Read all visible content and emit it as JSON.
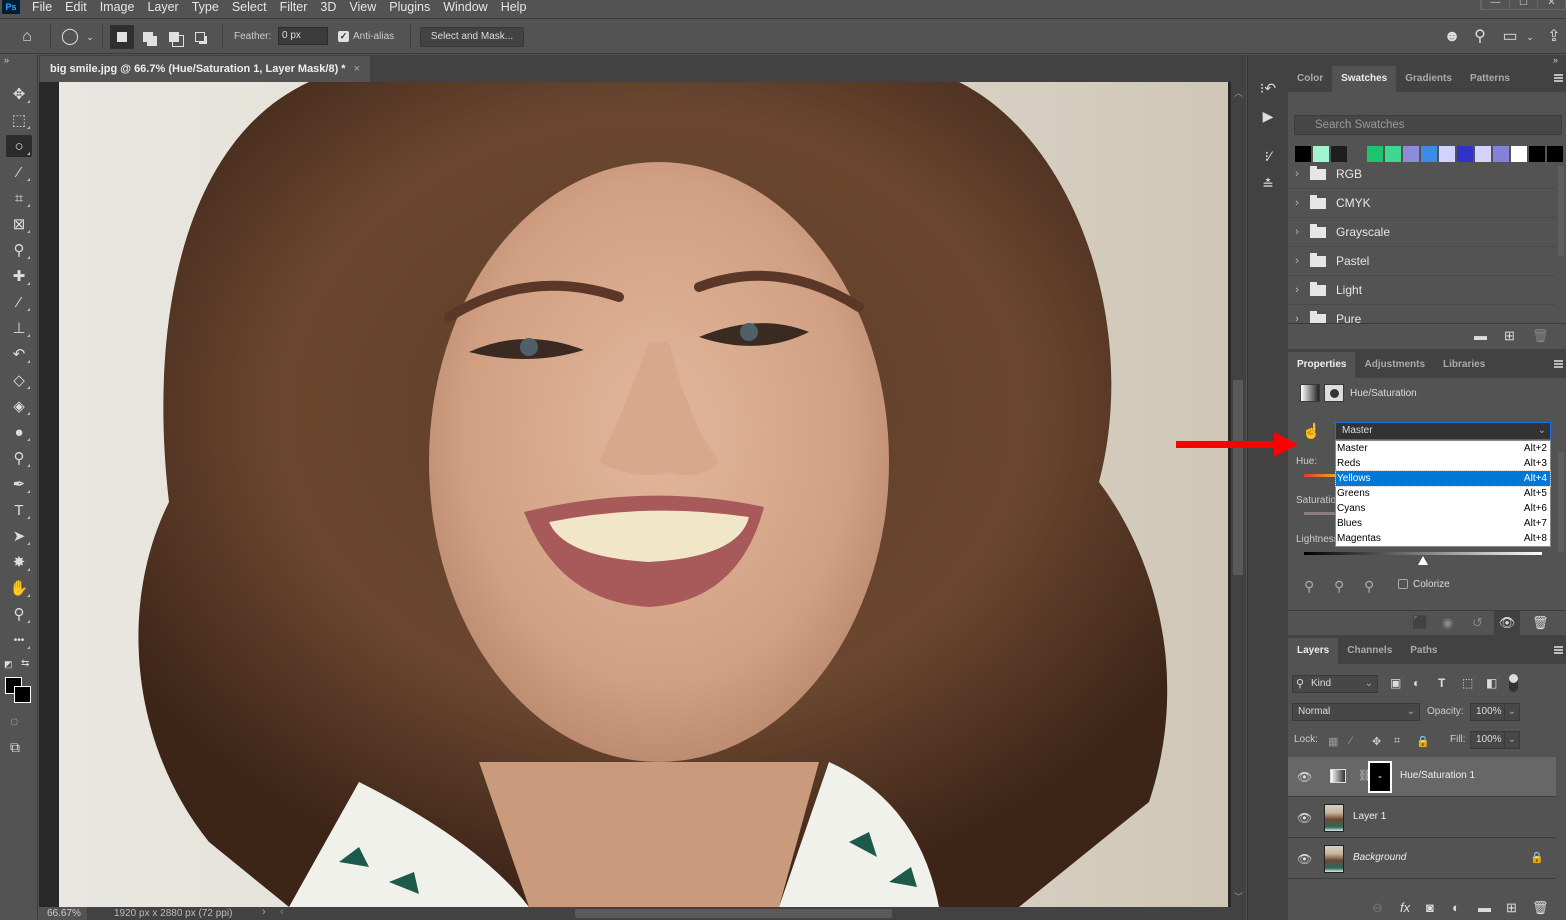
{
  "app": {
    "logo": "Ps",
    "menu": [
      "File",
      "Edit",
      "Image",
      "Layer",
      "Type",
      "Select",
      "Filter",
      "3D",
      "View",
      "Plugins",
      "Window",
      "Help"
    ]
  },
  "window_controls": {
    "minimize": "—",
    "maximize": "☐",
    "close": "✕"
  },
  "options_bar": {
    "feather_label": "Feather:",
    "feather_value": "0 px",
    "anti_alias_label": "Anti-alias",
    "anti_alias_checked": true,
    "select_and_mask": "Select and Mask..."
  },
  "document": {
    "tab_title": "big smile.jpg @ 66.7% (Hue/Saturation 1, Layer Mask/8) *",
    "close": "×",
    "zoom": "66.67%",
    "info": "1920 px x 2880 px (72 ppi)",
    "status_arrow": "›",
    "scroll_left": "‹"
  },
  "tools": [
    {
      "name": "move",
      "glyph": "✥"
    },
    {
      "name": "marquee",
      "glyph": "⬚"
    },
    {
      "name": "lasso",
      "glyph": "○",
      "active": true
    },
    {
      "name": "magic-wand",
      "glyph": "⁄"
    },
    {
      "name": "crop",
      "glyph": "⌗"
    },
    {
      "name": "frame",
      "glyph": "⊠"
    },
    {
      "name": "eyedropper",
      "glyph": "⚲"
    },
    {
      "name": "healing-brush",
      "glyph": "✚"
    },
    {
      "name": "brush",
      "glyph": "⁄"
    },
    {
      "name": "clone-stamp",
      "glyph": "⊥"
    },
    {
      "name": "history-brush",
      "glyph": "↶"
    },
    {
      "name": "eraser",
      "glyph": "◇"
    },
    {
      "name": "paint-bucket",
      "glyph": "◈"
    },
    {
      "name": "blur",
      "glyph": "●"
    },
    {
      "name": "dodge",
      "glyph": "⚲"
    },
    {
      "name": "pen",
      "glyph": "✒"
    },
    {
      "name": "type",
      "glyph": "T"
    },
    {
      "name": "path-selection",
      "glyph": "➤"
    },
    {
      "name": "custom-shape",
      "glyph": "✸"
    },
    {
      "name": "hand",
      "glyph": "✋"
    },
    {
      "name": "zoom",
      "glyph": "⚲"
    },
    {
      "name": "more-tools",
      "glyph": "•••"
    }
  ],
  "colors": {
    "foreground": "#000000",
    "background": "#000000"
  },
  "swatches_panel": {
    "tabs": [
      "Color",
      "Swatches",
      "Gradients",
      "Patterns"
    ],
    "active_tab": "Swatches",
    "search_placeholder": "Search Swatches",
    "recent": [
      "#000000",
      "#a0f5d0",
      "#1e1e1e",
      "#535353",
      "#1dc46e",
      "#40d890",
      "#8c8cdc",
      "#3c8ce6",
      "#d2d2ff",
      "#3232c8",
      "#d2d2fa",
      "#8282dc",
      "#ffffff",
      "#000000",
      "#000000"
    ],
    "groups": [
      "RGB",
      "CMYK",
      "Grayscale",
      "Pastel",
      "Light",
      "Pure"
    ]
  },
  "properties_panel": {
    "tabs": [
      "Properties",
      "Adjustments",
      "Libraries"
    ],
    "active_tab": "Properties",
    "title": "Hue/Saturation",
    "preset_selected": "Master",
    "dropdown_options": [
      {
        "label": "Master",
        "shortcut": "Alt+2"
      },
      {
        "label": "Reds",
        "shortcut": "Alt+3"
      },
      {
        "label": "Yellows",
        "shortcut": "Alt+4",
        "highlighted": true
      },
      {
        "label": "Greens",
        "shortcut": "Alt+5"
      },
      {
        "label": "Cyans",
        "shortcut": "Alt+6"
      },
      {
        "label": "Blues",
        "shortcut": "Alt+7"
      },
      {
        "label": "Magentas",
        "shortcut": "Alt+8"
      }
    ],
    "hue_label": "Hue:",
    "saturation_label": "Saturation:",
    "lightness_label": "Lightness:",
    "lightness_slider_fraction": 0.5,
    "colorize_label": "Colorize",
    "colorize_checked": false
  },
  "layers_panel": {
    "tabs": [
      "Layers",
      "Channels",
      "Paths"
    ],
    "active_tab": "Layers",
    "filter": "Kind",
    "blend_mode": "Normal",
    "opacity_label": "Opacity:",
    "opacity": "100%",
    "lock_label": "Lock:",
    "fill_label": "Fill:",
    "fill": "100%",
    "layers": [
      {
        "name": "Hue/Saturation 1",
        "type": "adjustment",
        "visible": true,
        "selected": true
      },
      {
        "name": "Layer 1",
        "type": "pixel",
        "visible": true
      },
      {
        "name": "Background",
        "type": "pixel",
        "visible": true,
        "locked": true,
        "italic": true
      }
    ]
  },
  "annotation": {
    "arrow_color": "#ff0000"
  }
}
